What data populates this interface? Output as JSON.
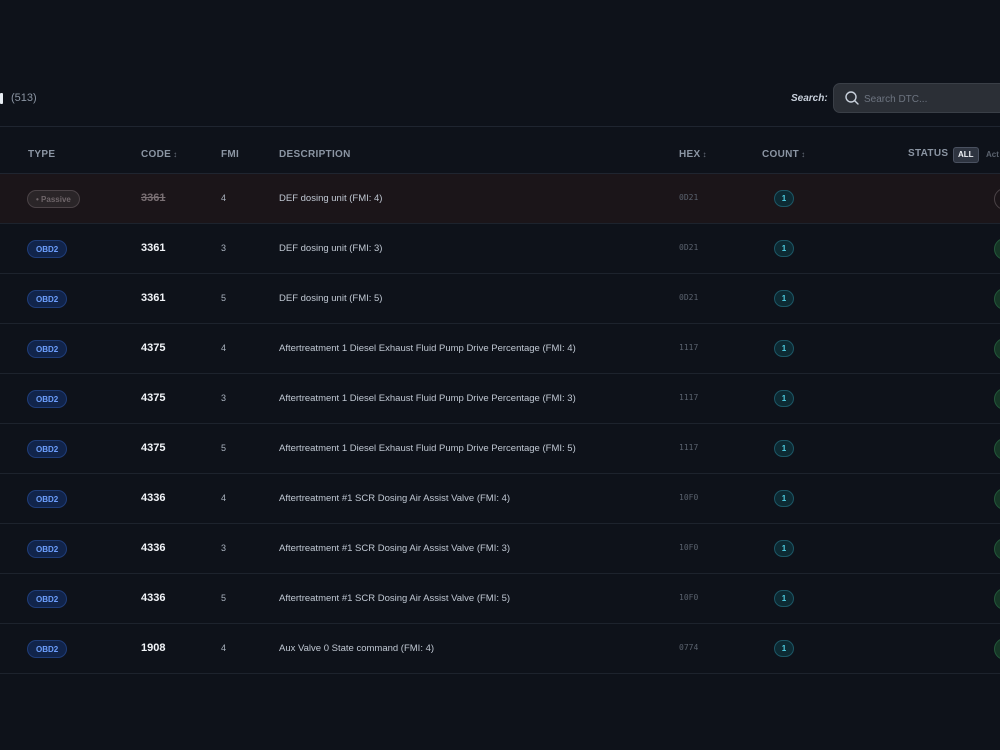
{
  "header": {
    "count_text": "(513)",
    "search_label": "Search:",
    "search_placeholder": "Search DTC..."
  },
  "columns": {
    "type": "TYPE",
    "code": "CODE",
    "fmi": "FMI",
    "description": "DESCRIPTION",
    "hex": "HEX",
    "count": "COUNT",
    "status": "STATUS",
    "status_filter": "ALL",
    "status_clipped": "Act"
  },
  "rows": [
    {
      "type": "Passive",
      "code": "3361",
      "fmi": "4",
      "description": "DEF dosing unit (FMI: 4)",
      "hex": "0D21",
      "count": "1"
    },
    {
      "type": "OBD2",
      "code": "3361",
      "fmi": "3",
      "description": "DEF dosing unit (FMI: 3)",
      "hex": "0D21",
      "count": "1"
    },
    {
      "type": "OBD2",
      "code": "3361",
      "fmi": "5",
      "description": "DEF dosing unit (FMI: 5)",
      "hex": "0D21",
      "count": "1"
    },
    {
      "type": "OBD2",
      "code": "4375",
      "fmi": "4",
      "description": "Aftertreatment 1 Diesel Exhaust Fluid Pump Drive Percentage (FMI: 4)",
      "hex": "1117",
      "count": "1"
    },
    {
      "type": "OBD2",
      "code": "4375",
      "fmi": "3",
      "description": "Aftertreatment 1 Diesel Exhaust Fluid Pump Drive Percentage (FMI: 3)",
      "hex": "1117",
      "count": "1"
    },
    {
      "type": "OBD2",
      "code": "4375",
      "fmi": "5",
      "description": "Aftertreatment 1 Diesel Exhaust Fluid Pump Drive Percentage (FMI: 5)",
      "hex": "1117",
      "count": "1"
    },
    {
      "type": "OBD2",
      "code": "4336",
      "fmi": "4",
      "description": "Aftertreatment #1 SCR Dosing Air Assist Valve (FMI: 4)",
      "hex": "10F0",
      "count": "1"
    },
    {
      "type": "OBD2",
      "code": "4336",
      "fmi": "3",
      "description": "Aftertreatment #1 SCR Dosing Air Assist Valve (FMI: 3)",
      "hex": "10F0",
      "count": "1"
    },
    {
      "type": "OBD2",
      "code": "4336",
      "fmi": "5",
      "description": "Aftertreatment #1 SCR Dosing Air Assist Valve (FMI: 5)",
      "hex": "10F0",
      "count": "1"
    },
    {
      "type": "OBD2",
      "code": "1908",
      "fmi": "4",
      "description": "Aux Valve 0 State command (FMI: 4)",
      "hex": "0774",
      "count": "1"
    }
  ],
  "colors": {
    "background": "#0e121a",
    "obd2_badge_text": "#6ea0ff",
    "count_badge_text": "#4fd1e5",
    "status_active": "#163626"
  }
}
